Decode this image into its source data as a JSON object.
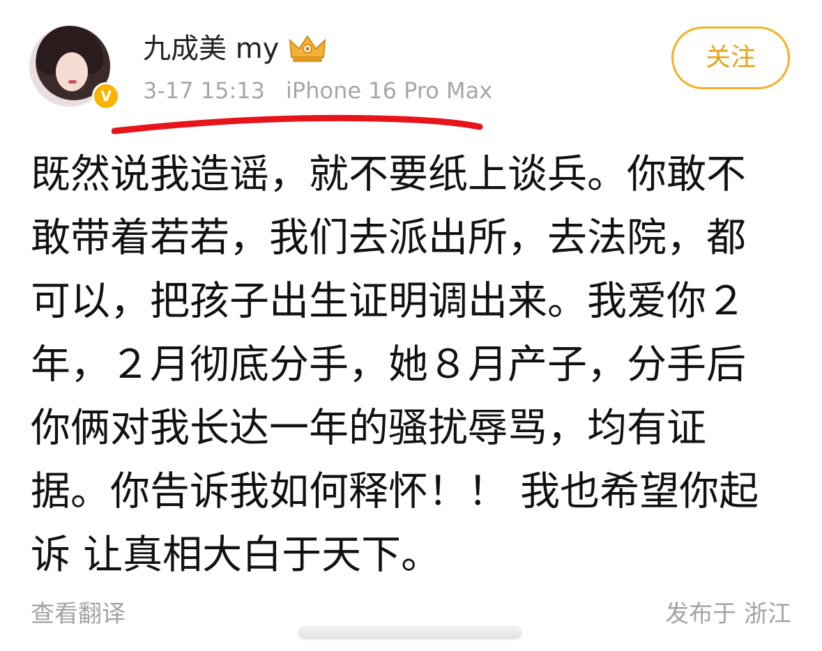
{
  "post": {
    "author": "九成美 my",
    "date": "3-17 15:13",
    "device": "iPhone 16 Pro Max",
    "follow_label": "关注",
    "verified_badge": "V",
    "body_lines": [
      "既然说我造谣，就不要纸上谈兵。你敢不",
      "敢带着若若，我们去派出所，去法院，都",
      "可以，把孩子出生证明调出来。我爱你２",
      "年，２月彻底分手，她８月产子，分手后",
      "你俩对我长达一年的骚扰辱骂，均有证",
      "据。你告诉我如何释怀！！ 我也希望你起",
      "诉 让真相大白于天下。"
    ],
    "translate_label": "查看翻译",
    "location": "发布于 浙江"
  },
  "icons": {
    "avatar": "avatar",
    "verified": "verified-badge-icon",
    "crown": "crown-icon"
  },
  "colors": {
    "accent": "#f5b021",
    "muted": "#a6a6a6",
    "underline": "#e8141b",
    "badge": "#f7b500"
  }
}
